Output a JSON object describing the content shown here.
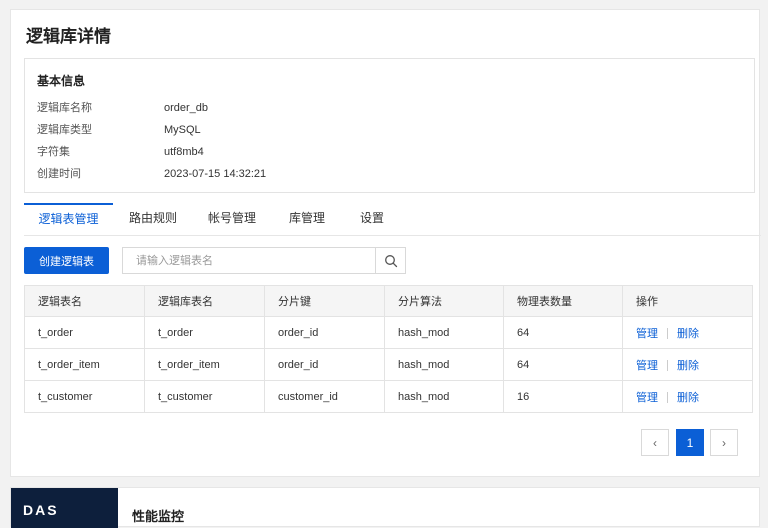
{
  "page": {
    "title": "逻辑库详情"
  },
  "info": {
    "heading": "基本信息",
    "rows": [
      {
        "label": "逻辑库名称",
        "value": "order_db"
      },
      {
        "label": "逻辑库类型",
        "value": "MySQL"
      },
      {
        "label": "字符集",
        "value": "utf8mb4"
      },
      {
        "label": "创建时间",
        "value": "2023-07-15 14:32:21"
      }
    ]
  },
  "tabs": [
    {
      "label": "逻辑表管理",
      "active": true
    },
    {
      "label": "路由规则",
      "active": false
    },
    {
      "label": "帐号管理",
      "active": false
    },
    {
      "label": "库管理",
      "active": false
    },
    {
      "label": "设置",
      "active": false
    }
  ],
  "toolbar": {
    "create_label": "创建逻辑表",
    "search_placeholder": "请输入逻辑表名",
    "search_value": "",
    "search_icon": "search-icon"
  },
  "table": {
    "headers": [
      "逻辑表名",
      "逻辑库表名",
      "分片键",
      "分片算法",
      "物理表数量",
      "操作"
    ],
    "rows": [
      {
        "logical": "t_order",
        "db_table": "t_order",
        "key": "order_id",
        "algo": "hash_mod",
        "count": "64"
      },
      {
        "logical": "t_order_item",
        "db_table": "t_order_item",
        "key": "order_id",
        "algo": "hash_mod",
        "count": "64"
      },
      {
        "logical": "t_customer",
        "db_table": "t_customer",
        "key": "customer_id",
        "algo": "hash_mod",
        "count": "16"
      }
    ],
    "action_manage": "管理",
    "action_delete": "删除"
  },
  "pagination": {
    "prev": "‹",
    "current": "1",
    "next": "›"
  },
  "bottom_card": {
    "logo_text": "DAS",
    "title": "性能监控"
  },
  "colors": {
    "accent": "#0b5fd6",
    "logo_bg": "#0d1f3c"
  }
}
